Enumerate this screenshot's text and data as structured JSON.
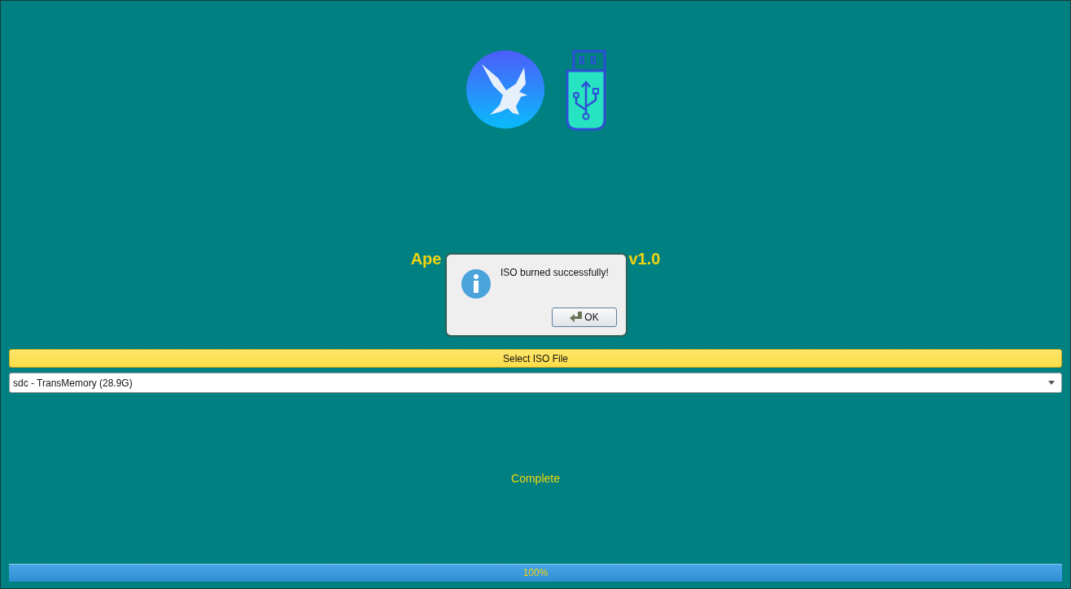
{
  "title_visible_parts": [
    "Ape",
    "v1.0"
  ],
  "select_iso_button": "Select ISO File",
  "device_combo": {
    "value": "sdc - TransMemory (28.9G)"
  },
  "status": "Complete",
  "progress": {
    "level": 1.0,
    "reading": "100%"
  },
  "dialog": {
    "message": "ISO burned successfully!",
    "button": "OK"
  }
}
